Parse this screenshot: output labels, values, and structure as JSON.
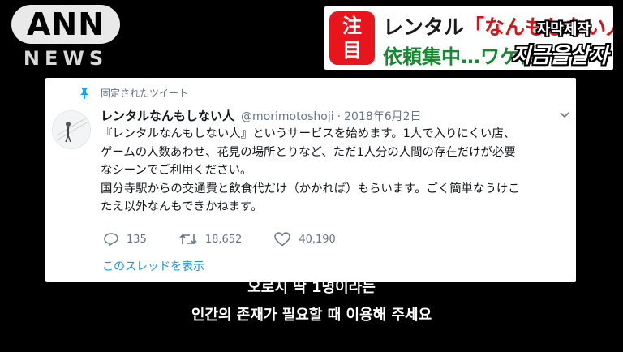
{
  "logo": {
    "top": "ANN",
    "bottom": "NEWS"
  },
  "headline": {
    "badge_chars": [
      "注",
      "目"
    ],
    "line1_main": "レンタル",
    "line1_quote": "「なんもしない人」",
    "line2": "依頼集中…ワケは",
    "overlay_top": "자막제작",
    "overlay_bottom": "지금을살자"
  },
  "tweet": {
    "pinned_label": "固定されたツイート",
    "name": "レンタルなんもしない人",
    "handle": "@morimotoshoji",
    "separator": "·",
    "date": "2018年6月2日",
    "lines": [
      "『レンタルなんもしない人』というサービスを始めます。1人で入りにくい店、",
      "ゲームの人数あわせ、花見の場所とりなど、ただ1人分の人間の存在だけが必要",
      "なシーンでご利用ください。",
      "国分寺駅からの交通費と飲食代だけ（かかれば）もらいます。ごく簡単なうけこ",
      "たえ以外なんもできかねます。"
    ],
    "replies": "135",
    "retweets": "18,652",
    "likes": "40,190",
    "thread_link": "このスレッドを表示",
    "icons": [
      "pin-icon",
      "chevron-down-icon",
      "reply-icon",
      "retweet-icon",
      "heart-icon"
    ]
  },
  "subtitles": {
    "line1": "오로지 딱 1명이라는",
    "line2": "인간의 존재가 필요할 때 이용해 주세요"
  }
}
